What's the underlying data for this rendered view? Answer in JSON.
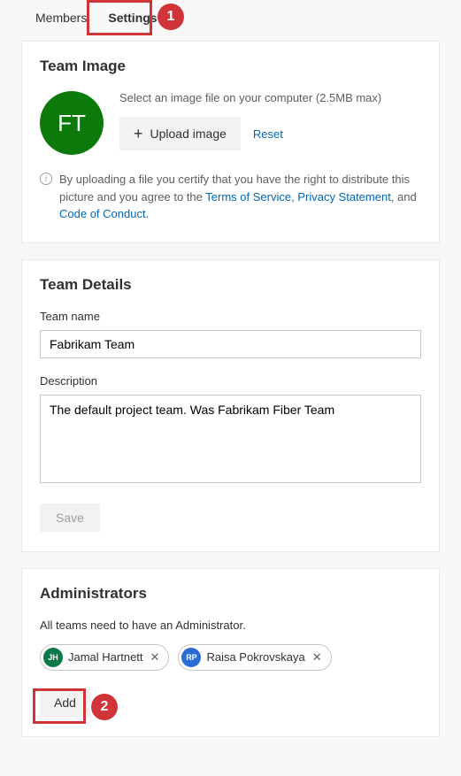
{
  "tabs": {
    "members": "Members",
    "settings": "Settings"
  },
  "callouts": {
    "one": "1",
    "two": "2"
  },
  "teamImage": {
    "heading": "Team Image",
    "avatarInitials": "FT",
    "hint": "Select an image file on your computer (2.5MB max)",
    "uploadLabel": "Upload image",
    "resetLabel": "Reset",
    "disclaimerPrefix": "By uploading a file you certify that you have the right to distribute this picture and you agree to the ",
    "tosLabel": "Terms of Service",
    "sep1": ", ",
    "privacyLabel": "Privacy Statement",
    "sep2": ", and ",
    "cocLabel": "Code of Conduct",
    "period": "."
  },
  "teamDetails": {
    "heading": "Team Details",
    "nameLabel": "Team name",
    "nameValue": "Fabrikam Team",
    "descLabel": "Description",
    "descValue": "The default project team. Was Fabrikam Fiber Team",
    "saveLabel": "Save"
  },
  "admins": {
    "heading": "Administrators",
    "desc": "All teams need to have an Administrator.",
    "people": [
      {
        "initials": "JH",
        "name": "Jamal Hartnett",
        "color": "#0b7a4b"
      },
      {
        "initials": "RP",
        "name": "Raisa Pokrovskaya",
        "color": "#2b6cd4"
      }
    ],
    "addLabel": "Add"
  }
}
